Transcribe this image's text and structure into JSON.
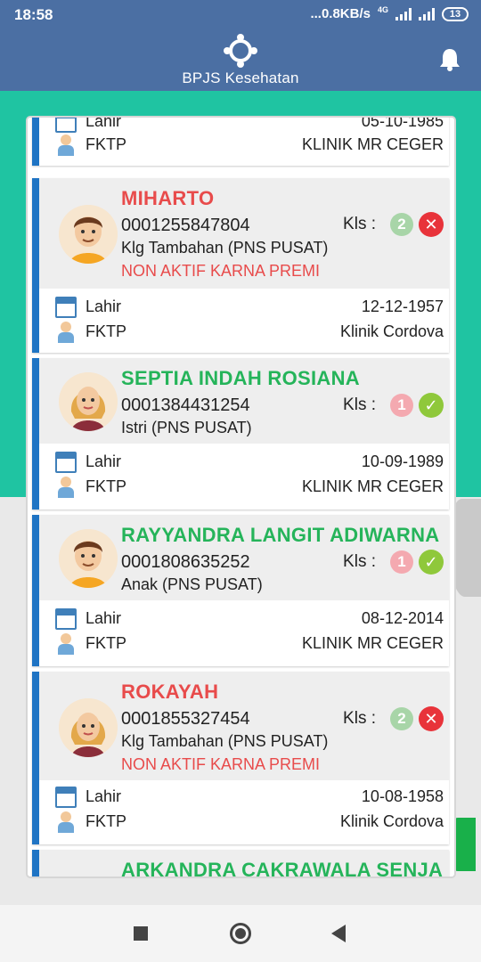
{
  "status_bar": {
    "time": "18:58",
    "speed": "...0.8KB/s",
    "network": "4G",
    "battery": "13"
  },
  "header": {
    "app_name": "BPJS Kesehatan",
    "logo_icon": "bpjs-logo-icon",
    "notification_icon": "bell-icon"
  },
  "colors": {
    "header": "#4b6fa3",
    "band": "#1fc4a2",
    "card_accent": "#1f74c4",
    "inactive_name": "#e84b4b",
    "active_name": "#25b45a"
  },
  "partial_top": {
    "lahir_label": "Lahir",
    "lahir_value": "05-10-1985",
    "fktp_label": "FKTP",
    "fktp_value": "KLINIK MR CEGER"
  },
  "members": [
    {
      "name": "MIHARTO",
      "nik": "0001255847804",
      "relation": "Klg Tambahan (PNS PUSAT)",
      "status": "NON AKTIF KARNA PREMI",
      "kls_label": "Kls :",
      "kls": "2",
      "active": false,
      "state_icon": "close-icon",
      "avatar": "male-avatar-icon",
      "lahir_label": "Lahir",
      "lahir": "12-12-1957",
      "fktp_label": "FKTP",
      "fktp": "Klinik Cordova"
    },
    {
      "name": "SEPTIA INDAH ROSIANA",
      "nik": "0001384431254",
      "relation": "Istri (PNS PUSAT)",
      "status": "",
      "kls_label": "Kls :",
      "kls": "1",
      "active": true,
      "state_icon": "check-icon",
      "avatar": "female-avatar-icon",
      "lahir_label": "Lahir",
      "lahir": "10-09-1989",
      "fktp_label": "FKTP",
      "fktp": "KLINIK MR CEGER"
    },
    {
      "name": "RAYYANDRA LANGIT ADIWARNA",
      "nik": "0001808635252",
      "relation": "Anak (PNS PUSAT)",
      "status": "",
      "kls_label": "Kls :",
      "kls": "1",
      "active": true,
      "state_icon": "check-icon",
      "avatar": "male-avatar-icon",
      "lahir_label": "Lahir",
      "lahir": "08-12-2014",
      "fktp_label": "FKTP",
      "fktp": "KLINIK MR CEGER"
    },
    {
      "name": "ROKAYAH",
      "nik": "0001855327454",
      "relation": "Klg Tambahan (PNS PUSAT)",
      "status": "NON AKTIF KARNA PREMI",
      "kls_label": "Kls :",
      "kls": "2",
      "active": false,
      "state_icon": "close-icon",
      "avatar": "female-avatar-icon",
      "lahir_label": "Lahir",
      "lahir": "10-08-1958",
      "fktp_label": "FKTP",
      "fktp": "Klinik Cordova"
    }
  ],
  "partial_bottom": {
    "name": "ARKANDRA CAKRAWALA SENJA"
  },
  "nav": {
    "recent_icon": "recent-apps-icon",
    "home_icon": "home-icon",
    "back_icon": "back-icon"
  }
}
